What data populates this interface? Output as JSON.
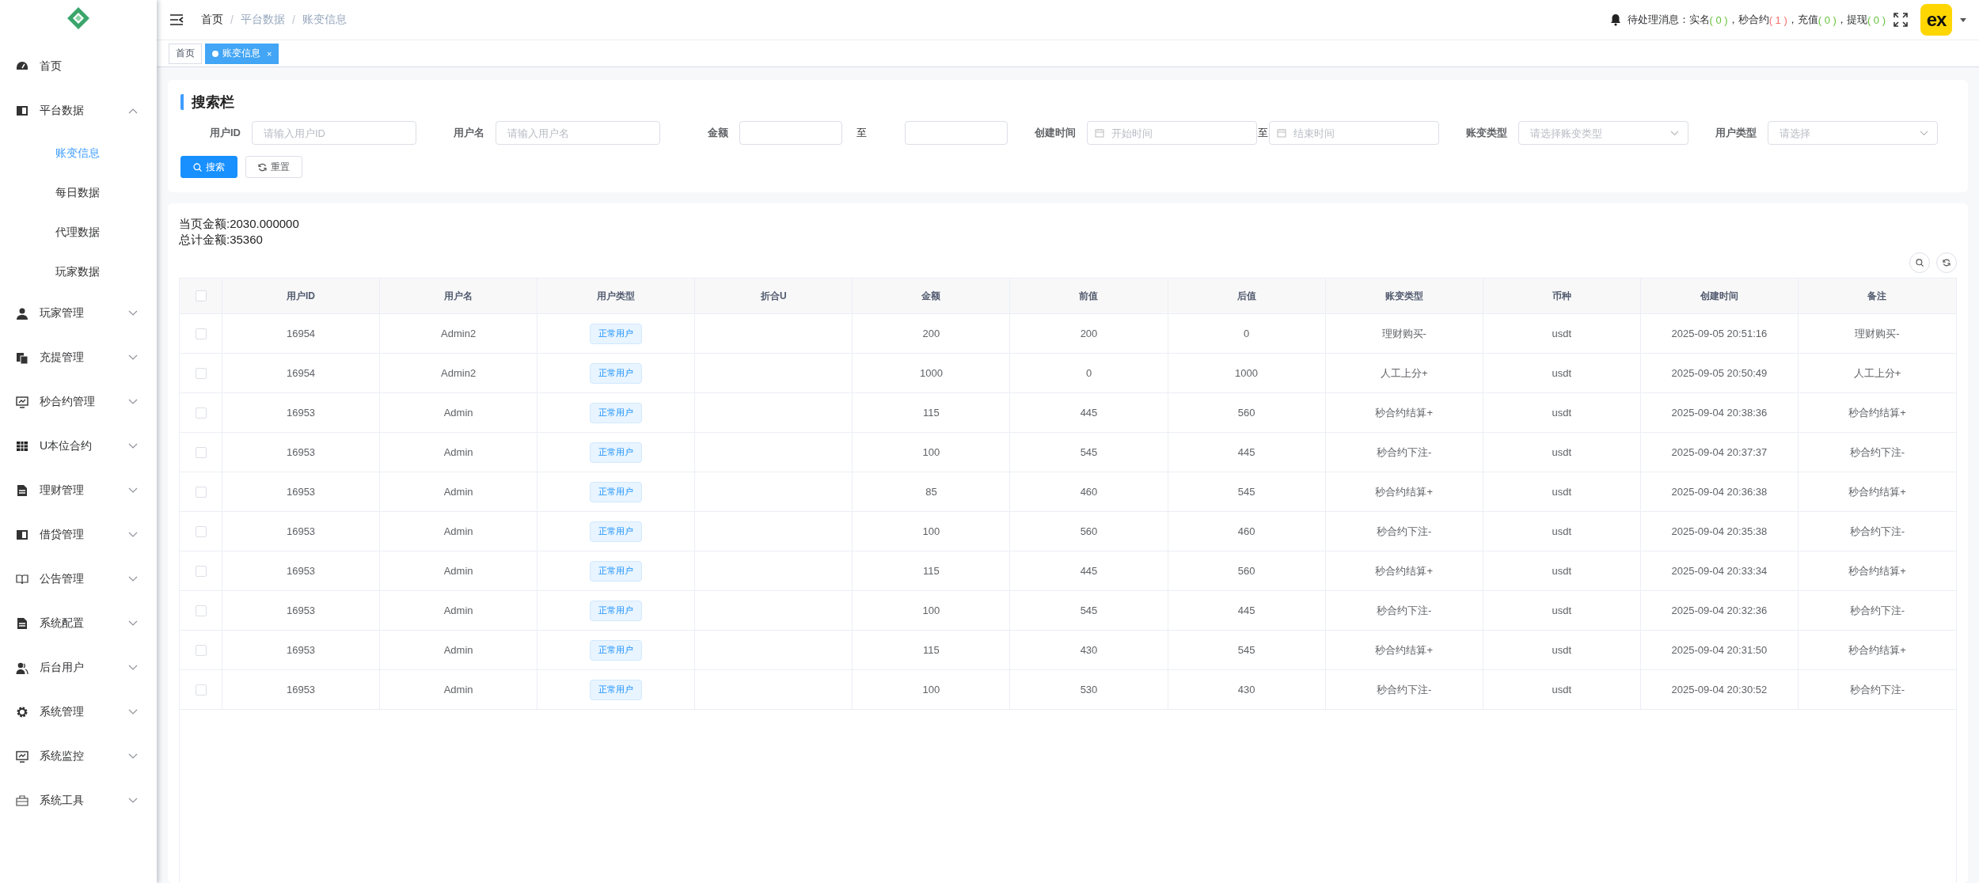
{
  "sidebar": {
    "items": [
      {
        "label": "首页"
      },
      {
        "label": "平台数据",
        "expanded": true,
        "children": [
          {
            "label": "账变信息",
            "selected": true
          },
          {
            "label": "每日数据",
            "selected": false
          },
          {
            "label": "代理数据",
            "selected": false
          },
          {
            "label": "玩家数据",
            "selected": false
          }
        ]
      },
      {
        "label": "玩家管理",
        "expanded": false
      },
      {
        "label": "充提管理",
        "expanded": false
      },
      {
        "label": "秒合约管理",
        "expanded": false
      },
      {
        "label": "U本位合约",
        "expanded": false
      },
      {
        "label": "理财管理",
        "expanded": false
      },
      {
        "label": "借贷管理",
        "expanded": false
      },
      {
        "label": "公告管理",
        "expanded": false
      },
      {
        "label": "系统配置",
        "expanded": false
      },
      {
        "label": "后台用户",
        "expanded": false
      },
      {
        "label": "系统管理",
        "expanded": false
      },
      {
        "label": "系统监控",
        "expanded": false
      },
      {
        "label": "系统工具",
        "expanded": false
      }
    ]
  },
  "breadcrumb": {
    "separator": "/",
    "items": [
      "首页",
      "平台数据",
      "账变信息"
    ]
  },
  "notices": {
    "label": "待处理消息：",
    "items": [
      {
        "name": "实名",
        "count": "( 0 )",
        "separator": "，",
        "color": "#67c23a"
      },
      {
        "name": "秒合约",
        "count": "( 1 )",
        "separator": "，",
        "color": "#f56c6c"
      },
      {
        "name": "充值",
        "count": "( 0 )",
        "separator": "，",
        "color": "#67c23a"
      },
      {
        "name": "提现",
        "count": "( 0 )",
        "color": "#67c23a"
      }
    ]
  },
  "avatar": {
    "text": "ex"
  },
  "tabs": [
    {
      "label": "首页",
      "selected": false
    },
    {
      "label": "账变信息",
      "selected": true,
      "close": "×"
    }
  ],
  "search": {
    "title": "搜索栏",
    "fields": [
      {
        "kind": "input",
        "label": "用户ID",
        "placeholder": "请输入用户ID"
      },
      {
        "kind": "input",
        "label": "用户名",
        "placeholder": "请输入用户名"
      },
      {
        "kind": "range",
        "label": "金额",
        "separator": "至"
      },
      {
        "kind": "daterange",
        "label": "创建时间",
        "start_placeholder": "开始时间",
        "separator": "至",
        "end_placeholder": "结束时间"
      },
      {
        "kind": "select",
        "label": "账变类型",
        "placeholder": "请选择账变类型"
      },
      {
        "kind": "select",
        "label": "用户类型",
        "placeholder": "请选择"
      }
    ],
    "buttons": [
      {
        "label": "搜索",
        "kind": "primary"
      },
      {
        "label": "重置",
        "kind": "default"
      }
    ]
  },
  "summary": [
    "当页金额:2030.000000",
    "总计金额:35360"
  ],
  "table": {
    "header_checked": false,
    "columns": [
      "用户ID",
      "用户名",
      "用户类型",
      "折合U",
      "金额",
      "前值",
      "后值",
      "账变类型",
      "币种",
      "创建时间",
      "备注"
    ],
    "rows": [
      {
        "checked": false,
        "cells": [
          "16954",
          "Admin2",
          "正常用户",
          "",
          "200",
          "200",
          "0",
          "理财购买-",
          "usdt",
          "2025-09-05 20:51:16",
          "理财购买-"
        ]
      },
      {
        "checked": false,
        "cells": [
          "16954",
          "Admin2",
          "正常用户",
          "",
          "1000",
          "0",
          "1000",
          "人工上分+",
          "usdt",
          "2025-09-05 20:50:49",
          "人工上分+"
        ]
      },
      {
        "checked": false,
        "cells": [
          "16953",
          "Admin",
          "正常用户",
          "",
          "115",
          "445",
          "560",
          "秒合约结算+",
          "usdt",
          "2025-09-04 20:38:36",
          "秒合约结算+"
        ]
      },
      {
        "checked": false,
        "cells": [
          "16953",
          "Admin",
          "正常用户",
          "",
          "100",
          "545",
          "445",
          "秒合约下注-",
          "usdt",
          "2025-09-04 20:37:37",
          "秒合约下注-"
        ]
      },
      {
        "checked": false,
        "cells": [
          "16953",
          "Admin",
          "正常用户",
          "",
          "85",
          "460",
          "545",
          "秒合约结算+",
          "usdt",
          "2025-09-04 20:36:38",
          "秒合约结算+"
        ]
      },
      {
        "checked": false,
        "cells": [
          "16953",
          "Admin",
          "正常用户",
          "",
          "100",
          "560",
          "460",
          "秒合约下注-",
          "usdt",
          "2025-09-04 20:35:38",
          "秒合约下注-"
        ]
      },
      {
        "checked": false,
        "cells": [
          "16953",
          "Admin",
          "正常用户",
          "",
          "115",
          "445",
          "560",
          "秒合约结算+",
          "usdt",
          "2025-09-04 20:33:34",
          "秒合约结算+"
        ]
      },
      {
        "checked": false,
        "cells": [
          "16953",
          "Admin",
          "正常用户",
          "",
          "100",
          "545",
          "445",
          "秒合约下注-",
          "usdt",
          "2025-09-04 20:32:36",
          "秒合约下注-"
        ]
      },
      {
        "checked": false,
        "cells": [
          "16953",
          "Admin",
          "正常用户",
          "",
          "115",
          "430",
          "545",
          "秒合约结算+",
          "usdt",
          "2025-09-04 20:31:50",
          "秒合约结算+"
        ]
      },
      {
        "checked": false,
        "cells": [
          "16953",
          "Admin",
          "正常用户",
          "",
          "100",
          "530",
          "430",
          "秒合约下注-",
          "usdt",
          "2025-09-04 20:30:52",
          "秒合约下注-"
        ]
      }
    ]
  }
}
